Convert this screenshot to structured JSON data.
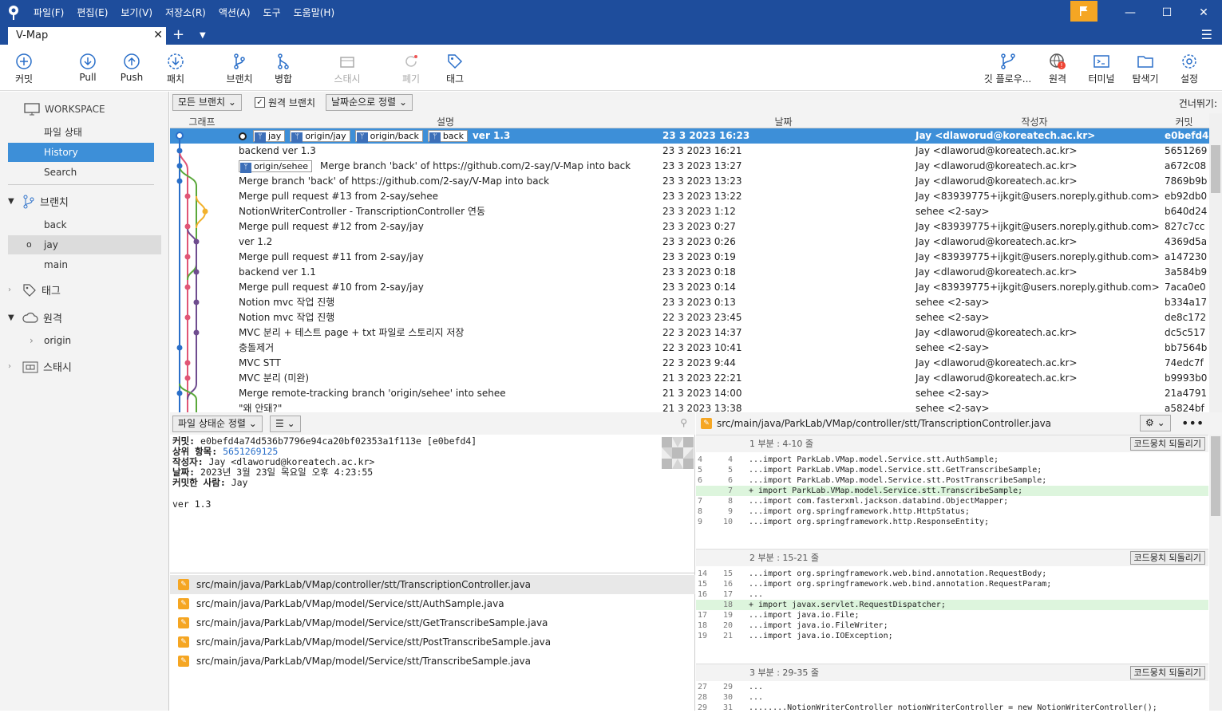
{
  "menu": [
    "파일(F)",
    "편집(E)",
    "보기(V)",
    "저장소(R)",
    "액션(A)",
    "도구",
    "도움말(H)"
  ],
  "tab": {
    "title": "V-Map"
  },
  "toolbar": {
    "commit": "커밋",
    "pull": "Pull",
    "push": "Push",
    "patch": "패치",
    "branch": "브랜치",
    "merge": "병합",
    "stash": "스태시",
    "discard": "폐기",
    "tag": "태그",
    "gitflow": "깃 플로우...",
    "remote": "원격",
    "terminal": "터미널",
    "explorer": "탐색기",
    "settings": "설정"
  },
  "sidebar": {
    "workspace": "WORKSPACE",
    "file_status": "파일 상태",
    "history": "History",
    "search": "Search",
    "branches": "브랜치",
    "branch_items": [
      "back",
      "jay",
      "main"
    ],
    "tags": "태그",
    "remotes": "원격",
    "remote_items": [
      "origin"
    ],
    "stash": "스태시"
  },
  "filter": {
    "all_branches": "모든 브랜치",
    "remote_branches": "원격 브랜치",
    "sort": "날짜순으로 정렬",
    "skip": "건너뛰기:"
  },
  "columns": {
    "graph": "그래프",
    "desc": "설명",
    "date": "날짜",
    "author": "작성자",
    "commit": "커밋"
  },
  "selected_tags": [
    "jay",
    "origin/jay",
    "origin/back",
    "back"
  ],
  "row3_tag": "origin/sehee",
  "commits": [
    {
      "desc": "ver 1.3",
      "date": "23 3 2023 16:23",
      "author": "Jay <dlaworud@koreatech.ac.kr>",
      "hash": "e0befd4"
    },
    {
      "desc": "backend ver 1.3",
      "date": "23 3 2023 16:21",
      "author": "Jay <dlaworud@koreatech.ac.kr>",
      "hash": "5651269"
    },
    {
      "desc": "Merge branch 'back' of https://github.com/2-say/V-Map into back",
      "date": "23 3 2023 13:27",
      "author": "Jay <dlaworud@koreatech.ac.kr>",
      "hash": "a672c08"
    },
    {
      "desc": "Merge branch 'back' of https://github.com/2-say/V-Map into back",
      "date": "23 3 2023 13:23",
      "author": "Jay <dlaworud@koreatech.ac.kr>",
      "hash": "7869b9b"
    },
    {
      "desc": "Merge pull request #13 from 2-say/sehee",
      "date": "23 3 2023 13:22",
      "author": "Jay <83939775+ijkgit@users.noreply.github.com>",
      "hash": "eb92db0"
    },
    {
      "desc": "NotionWriterController - TranscriptionController 연동",
      "date": "23 3 2023 1:12",
      "author": "sehee <2-say>",
      "hash": "b640d24"
    },
    {
      "desc": "Merge pull request #12 from 2-say/jay",
      "date": "23 3 2023 0:27",
      "author": "Jay <83939775+ijkgit@users.noreply.github.com>",
      "hash": "827c7cc"
    },
    {
      "desc": "ver 1.2",
      "date": "23 3 2023 0:26",
      "author": "Jay <dlaworud@koreatech.ac.kr>",
      "hash": "4369d5a"
    },
    {
      "desc": "Merge pull request #11 from 2-say/jay",
      "date": "23 3 2023 0:19",
      "author": "Jay <83939775+ijkgit@users.noreply.github.com>",
      "hash": "a147230"
    },
    {
      "desc": "backend ver 1.1",
      "date": "23 3 2023 0:18",
      "author": "Jay <dlaworud@koreatech.ac.kr>",
      "hash": "3a584b9"
    },
    {
      "desc": "Merge pull request #10 from 2-say/jay",
      "date": "23 3 2023 0:14",
      "author": "Jay <83939775+ijkgit@users.noreply.github.com>",
      "hash": "7aca0e0"
    },
    {
      "desc": "Notion mvc 작업 진행",
      "date": "23 3 2023 0:13",
      "author": "sehee <2-say>",
      "hash": "b334a17"
    },
    {
      "desc": "Notion mvc 작업 진행",
      "date": "22 3 2023 23:45",
      "author": "sehee <2-say>",
      "hash": "de8c172"
    },
    {
      "desc": "MVC 분리 + 테스트 page + txt 파일로 스토리지 저장",
      "date": "22 3 2023 14:37",
      "author": "Jay <dlaworud@koreatech.ac.kr>",
      "hash": "dc5c517"
    },
    {
      "desc": "충돌제거",
      "date": "22 3 2023 10:41",
      "author": "sehee <2-say>",
      "hash": "bb7564b"
    },
    {
      "desc": "MVC STT",
      "date": "22 3 2023 9:44",
      "author": "Jay <dlaworud@koreatech.ac.kr>",
      "hash": "74edc7f"
    },
    {
      "desc": "MVC 분리 (미완)",
      "date": "21 3 2023 22:21",
      "author": "Jay <dlaworud@koreatech.ac.kr>",
      "hash": "b9993b0"
    },
    {
      "desc": "Merge remote-tracking branch 'origin/sehee' into sehee",
      "date": "21 3 2023 14:00",
      "author": "sehee <2-say>",
      "hash": "21a4791"
    },
    {
      "desc": "\"왜 안돼?\"",
      "date": "21 3 2023 13:38",
      "author": "sehee <2-say>",
      "hash": "a5824bf"
    }
  ],
  "filelist_bar": {
    "sort": "파일 상태순 정렬"
  },
  "details": {
    "commit_label": "커밋:",
    "commit_value": "e0befd4a74d536b7796e94ca20bf02353a1f113e [e0befd4]",
    "parent_label": "상위 항목:",
    "parent_value": "5651269125",
    "author_label": "작성자:",
    "author_value": "Jay <dlaworud@koreatech.ac.kr>",
    "date_label": "날짜:",
    "date_value": "2023년 3월 23일 목요일 오후 4:23:55",
    "committer_label": "커밋한 사람:",
    "committer_value": "Jay",
    "message": "ver 1.3"
  },
  "files": [
    "src/main/java/ParkLab/VMap/controller/stt/TranscriptionController.java",
    "src/main/java/ParkLab/VMap/model/Service/stt/AuthSample.java",
    "src/main/java/ParkLab/VMap/model/Service/stt/GetTranscribeSample.java",
    "src/main/java/ParkLab/VMap/model/Service/stt/PostTranscribeSample.java",
    "src/main/java/ParkLab/VMap/model/Service/stt/TranscribeSample.java"
  ],
  "diff": {
    "path": "src/main/java/ParkLab/VMap/controller/stt/TranscriptionController.java",
    "revert": "코드뭉치 되돌리기",
    "hunk1": "1 부분 : 4-10 줄",
    "hunk2": "2 부분 : 15-21 줄",
    "hunk3": "3 부분 : 29-35 줄",
    "h1": [
      {
        "o": "4",
        "n": "4",
        "t": "...import ParkLab.VMap.model.Service.stt.AuthSample;"
      },
      {
        "o": "5",
        "n": "5",
        "t": "...import ParkLab.VMap.model.Service.stt.GetTranscribeSample;"
      },
      {
        "o": "6",
        "n": "6",
        "t": "...import ParkLab.VMap.model.Service.stt.PostTranscribeSample;"
      },
      {
        "o": "",
        "n": "7",
        "t": "+ import ParkLab.VMap.model.Service.stt.TranscribeSample;"
      },
      {
        "o": "7",
        "n": "8",
        "t": "...import com.fasterxml.jackson.databind.ObjectMapper;"
      },
      {
        "o": "8",
        "n": "9",
        "t": "...import org.springframework.http.HttpStatus;"
      },
      {
        "o": "9",
        "n": "10",
        "t": "...import org.springframework.http.ResponseEntity;"
      }
    ],
    "h2": [
      {
        "o": "14",
        "n": "15",
        "t": "...import org.springframework.web.bind.annotation.RequestBody;"
      },
      {
        "o": "15",
        "n": "16",
        "t": "...import org.springframework.web.bind.annotation.RequestParam;"
      },
      {
        "o": "16",
        "n": "17",
        "t": "..."
      },
      {
        "o": "",
        "n": "18",
        "t": "+ import javax.servlet.RequestDispatcher;"
      },
      {
        "o": "17",
        "n": "19",
        "t": "...import java.io.File;"
      },
      {
        "o": "18",
        "n": "20",
        "t": "...import java.io.FileWriter;"
      },
      {
        "o": "19",
        "n": "21",
        "t": "...import java.io.IOException;"
      }
    ],
    "h3": [
      {
        "o": "27",
        "n": "29",
        "t": "..."
      },
      {
        "o": "28",
        "n": "30",
        "t": "..."
      },
      {
        "o": "29",
        "n": "31",
        "t": "........NotionWriterController notionWriterController = new NotionWriterController();"
      }
    ]
  }
}
